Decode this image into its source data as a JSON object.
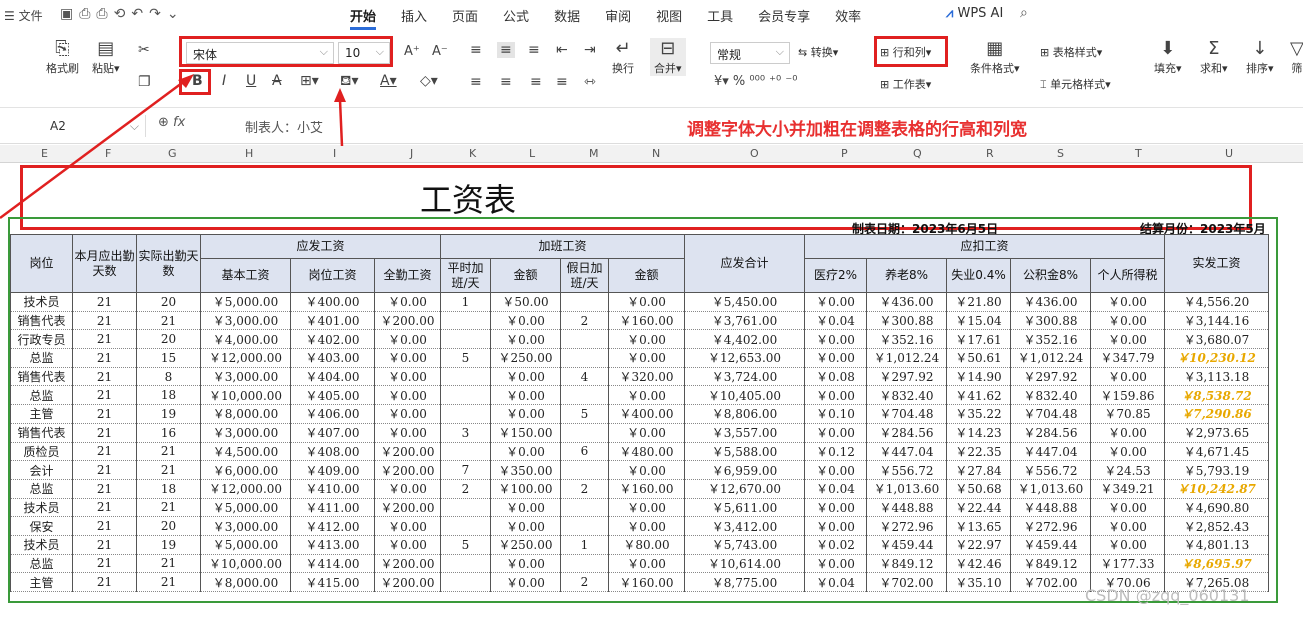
{
  "menu": {
    "file": "文件",
    "tabs": [
      "开始",
      "插入",
      "页面",
      "公式",
      "数据",
      "审阅",
      "视图",
      "工具",
      "会员专享",
      "效率"
    ],
    "ai": "WPS AI"
  },
  "ribbon": {
    "format_painter": "格式刷",
    "paste": "粘贴",
    "font": "宋体",
    "size": "10",
    "wrap": "换行",
    "merge": "合并",
    "number_format": "常规",
    "convert": "转换",
    "rowcol": "行和列",
    "worksheet": "工作表",
    "cond_format": "条件格式",
    "table_style": "表格样式",
    "cell_style": "单元格样式",
    "fill": "填充",
    "sum": "求和",
    "sort": "排序",
    "filter": "筛"
  },
  "formula": {
    "cell": "A2",
    "value": "制表人：小艾",
    "note": "调整字体大小并加粗在调整表格的行高和列宽"
  },
  "columns": [
    "E",
    "F",
    "G",
    "H",
    "I",
    "J",
    "K",
    "L",
    "M",
    "N",
    "O",
    "P",
    "Q",
    "R",
    "S",
    "T",
    "U"
  ],
  "sheet": {
    "title": "工资表",
    "date": "制表日期：2023年6月5日",
    "month": "结算月份：2023年5月",
    "watermark": "CSDN @zqq_060131"
  },
  "headers": {
    "post": "岗位",
    "days_due": "本月应出勤天数",
    "days_act": "实际出勤天数",
    "gross": "应发工资",
    "base": "基本工资",
    "post_pay": "岗位工资",
    "attend": "全勤工资",
    "ot": "加班工资",
    "ot_days": "平时加班/天",
    "amount": "金额",
    "hol_days": "假日加班/天",
    "amount2": "金额",
    "total": "应发合计",
    "deduct": "应扣工资",
    "med": "医疗2%",
    "pension": "养老8%",
    "unemp": "失业0.4%",
    "fund": "公积金8%",
    "tax": "个人所得税",
    "net": "实发工资"
  },
  "rows": [
    [
      "技术员",
      "21",
      "20",
      "￥5,000.00",
      "￥400.00",
      "￥0.00",
      "1",
      "￥50.00",
      "",
      "￥0.00",
      "￥5,450.00",
      "￥0.00",
      "￥436.00",
      "￥21.80",
      "￥436.00",
      "￥0.00",
      "￥4,556.20"
    ],
    [
      "销售代表",
      "21",
      "21",
      "￥3,000.00",
      "￥401.00",
      "￥200.00",
      "",
      "￥0.00",
      "2",
      "￥160.00",
      "￥3,761.00",
      "￥0.04",
      "￥300.88",
      "￥15.04",
      "￥300.88",
      "￥0.00",
      "￥3,144.16"
    ],
    [
      "行政专员",
      "21",
      "20",
      "￥4,000.00",
      "￥402.00",
      "￥0.00",
      "",
      "￥0.00",
      "",
      "￥0.00",
      "￥4,402.00",
      "￥0.00",
      "￥352.16",
      "￥17.61",
      "￥352.16",
      "￥0.00",
      "￥3,680.07"
    ],
    [
      "总监",
      "21",
      "15",
      "￥12,000.00",
      "￥403.00",
      "￥0.00",
      "5",
      "￥250.00",
      "",
      "￥0.00",
      "￥12,653.00",
      "￥0.00",
      "￥1,012.24",
      "￥50.61",
      "￥1,012.24",
      "￥347.79",
      "￥10,230.12"
    ],
    [
      "销售代表",
      "21",
      "8",
      "￥3,000.00",
      "￥404.00",
      "￥0.00",
      "",
      "￥0.00",
      "4",
      "￥320.00",
      "￥3,724.00",
      "￥0.08",
      "￥297.92",
      "￥14.90",
      "￥297.92",
      "￥0.00",
      "￥3,113.18"
    ],
    [
      "总监",
      "21",
      "18",
      "￥10,000.00",
      "￥405.00",
      "￥0.00",
      "",
      "￥0.00",
      "",
      "￥0.00",
      "￥10,405.00",
      "￥0.00",
      "￥832.40",
      "￥41.62",
      "￥832.40",
      "￥159.86",
      "￥8,538.72"
    ],
    [
      "主管",
      "21",
      "19",
      "￥8,000.00",
      "￥406.00",
      "￥0.00",
      "",
      "￥0.00",
      "5",
      "￥400.00",
      "￥8,806.00",
      "￥0.10",
      "￥704.48",
      "￥35.22",
      "￥704.48",
      "￥70.85",
      "￥7,290.86"
    ],
    [
      "销售代表",
      "21",
      "16",
      "￥3,000.00",
      "￥407.00",
      "￥0.00",
      "3",
      "￥150.00",
      "",
      "￥0.00",
      "￥3,557.00",
      "￥0.00",
      "￥284.56",
      "￥14.23",
      "￥284.56",
      "￥0.00",
      "￥2,973.65"
    ],
    [
      "质检员",
      "21",
      "21",
      "￥4,500.00",
      "￥408.00",
      "￥200.00",
      "",
      "￥0.00",
      "6",
      "￥480.00",
      "￥5,588.00",
      "￥0.12",
      "￥447.04",
      "￥22.35",
      "￥447.04",
      "￥0.00",
      "￥4,671.45"
    ],
    [
      "会计",
      "21",
      "21",
      "￥6,000.00",
      "￥409.00",
      "￥200.00",
      "7",
      "￥350.00",
      "",
      "￥0.00",
      "￥6,959.00",
      "￥0.00",
      "￥556.72",
      "￥27.84",
      "￥556.72",
      "￥24.53",
      "￥5,793.19"
    ],
    [
      "总监",
      "21",
      "18",
      "￥12,000.00",
      "￥410.00",
      "￥0.00",
      "2",
      "￥100.00",
      "2",
      "￥160.00",
      "￥12,670.00",
      "￥0.04",
      "￥1,013.60",
      "￥50.68",
      "￥1,013.60",
      "￥349.21",
      "￥10,242.87"
    ],
    [
      "技术员",
      "21",
      "21",
      "￥5,000.00",
      "￥411.00",
      "￥200.00",
      "",
      "￥0.00",
      "",
      "￥0.00",
      "￥5,611.00",
      "￥0.00",
      "￥448.88",
      "￥22.44",
      "￥448.88",
      "￥0.00",
      "￥4,690.80"
    ],
    [
      "保安",
      "21",
      "20",
      "￥3,000.00",
      "￥412.00",
      "￥0.00",
      "",
      "￥0.00",
      "",
      "￥0.00",
      "￥3,412.00",
      "￥0.00",
      "￥272.96",
      "￥13.65",
      "￥272.96",
      "￥0.00",
      "￥2,852.43"
    ],
    [
      "技术员",
      "21",
      "19",
      "￥5,000.00",
      "￥413.00",
      "￥0.00",
      "5",
      "￥250.00",
      "1",
      "￥80.00",
      "￥5,743.00",
      "￥0.02",
      "￥459.44",
      "￥22.97",
      "￥459.44",
      "￥0.00",
      "￥4,801.13"
    ],
    [
      "总监",
      "21",
      "21",
      "￥10,000.00",
      "￥414.00",
      "￥200.00",
      "",
      "￥0.00",
      "",
      "￥0.00",
      "￥10,614.00",
      "￥0.00",
      "￥849.12",
      "￥42.46",
      "￥849.12",
      "￥177.33",
      "￥8,695.97"
    ],
    [
      "主管",
      "21",
      "21",
      "￥8,000.00",
      "￥415.00",
      "￥200.00",
      "",
      "￥0.00",
      "2",
      "￥160.00",
      "￥8,775.00",
      "￥0.04",
      "￥702.00",
      "￥35.10",
      "￥702.00",
      "￥70.06",
      "￥7,265.08"
    ]
  ],
  "highlight_rows": [
    3,
    5,
    6,
    10,
    14
  ],
  "colors": {
    "accent": "#2b6cd8",
    "annot": "#e02020",
    "border_green": "#3a9a3a",
    "header_fill": "#dde3f0",
    "gold": "#e8a800"
  }
}
